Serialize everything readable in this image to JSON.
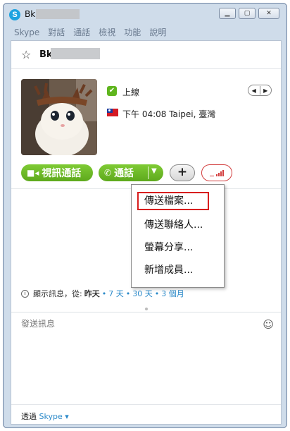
{
  "window": {
    "title": "Bk",
    "controls": [
      "minimize",
      "maximize",
      "close"
    ]
  },
  "menu": {
    "items": [
      "Skype",
      "對話",
      "通話",
      "檢視",
      "功能",
      "說明"
    ]
  },
  "contact": {
    "name": "Bk",
    "status": "上線",
    "local_time": "下午 04:08 Taipei, 臺灣"
  },
  "actions": {
    "video_call": "視訊通話",
    "call": "通話",
    "add": "+"
  },
  "dropdown": {
    "items": [
      "傳送檔案...",
      "傳送聯絡人...",
      "螢幕分享...",
      "新增成員..."
    ]
  },
  "history": {
    "prefix": "顯示訊息，從:",
    "current": "昨天",
    "options": [
      "7 天",
      "30 天",
      "3 個月"
    ]
  },
  "composer": {
    "placeholder": "發送訊息"
  },
  "footer": {
    "via_label": "透過",
    "via_service": "Skype"
  },
  "colors": {
    "accent_green": "#6ab82a",
    "link_blue": "#2a89c9",
    "highlight_red": "#d81e1e",
    "window_frame": "#cfdcea"
  }
}
